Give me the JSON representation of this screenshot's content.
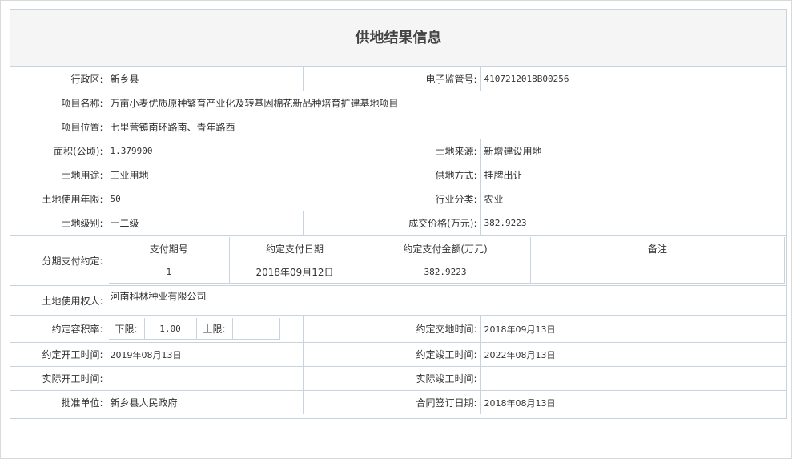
{
  "title": "供地结果信息",
  "fields": {
    "district_label": "行政区:",
    "district_value": "新乡县",
    "supervision_label": "电子监管号:",
    "supervision_value": "4107212018B00256",
    "project_name_label": "项目名称:",
    "project_name_value": "万亩小麦优质原种繁育产业化及转基因棉花新品种培育扩建基地项目",
    "project_location_label": "项目位置:",
    "project_location_value": "七里营镇南环路南、青年路西",
    "area_label": "面积(公顷):",
    "area_value": "1.379900",
    "land_source_label": "土地来源:",
    "land_source_value": "新增建设用地",
    "land_use_label": "土地用途:",
    "land_use_value": "工业用地",
    "supply_method_label": "供地方式:",
    "supply_method_value": "挂牌出让",
    "use_years_label": "土地使用年限:",
    "use_years_value": "50",
    "industry_label": "行业分类:",
    "industry_value": "农业",
    "land_level_label": "土地级别:",
    "land_level_value": "十二级",
    "price_label": "成交价格(万元):",
    "price_value": "382.9223",
    "installment_label": "分期支付约定:",
    "land_user_label": "土地使用权人:",
    "land_user_value": "河南科林种业有限公司",
    "far_label": "约定容积率:",
    "far_lower_label": "下限:",
    "far_lower_value": "1.00",
    "far_upper_label": "上限:",
    "far_upper_value": "",
    "delivery_time_label": "约定交地时间:",
    "delivery_time_value": "2018年09月13日",
    "start_time_label": "约定开工时间:",
    "start_time_value": "2019年08月13日",
    "completion_time_label": "约定竣工时间:",
    "completion_time_value": "2022年08月13日",
    "actual_start_label": "实际开工时间:",
    "actual_start_value": "",
    "actual_completion_label": "实际竣工时间:",
    "actual_completion_value": "",
    "approval_unit_label": "批准单位:",
    "approval_unit_value": "新乡县人民政府",
    "contract_date_label": "合同签订日期:",
    "contract_date_value": "2018年08月13日"
  },
  "payment_table": {
    "headers": [
      "支付期号",
      "约定支付日期",
      "约定支付金额(万元)",
      "备注"
    ],
    "rows": [
      [
        "1",
        "2018年09月12日",
        "382.9223",
        ""
      ]
    ]
  }
}
